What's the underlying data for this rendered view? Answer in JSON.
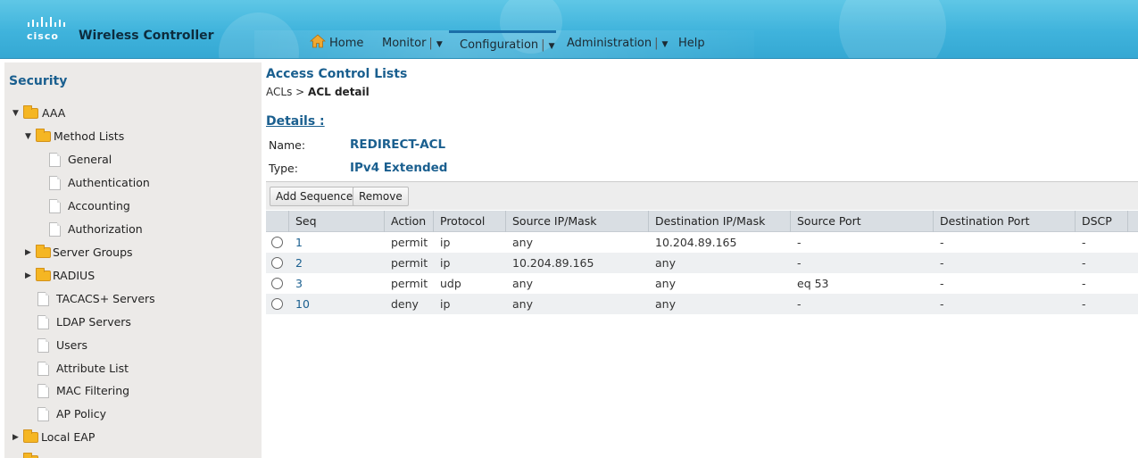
{
  "header": {
    "logo_text": "cisco",
    "brand": "Wireless Controller",
    "nav": [
      {
        "label": "Home",
        "icon": "home-icon",
        "dropdown": false,
        "active": false
      },
      {
        "label": "Monitor",
        "dropdown": true,
        "active": false
      },
      {
        "label": "Configuration",
        "dropdown": true,
        "active": true
      },
      {
        "label": "Administration",
        "dropdown": true,
        "active": false
      },
      {
        "label": "Help",
        "dropdown": false,
        "active": false
      }
    ],
    "dropdown_glyph": "▼",
    "separator": "|"
  },
  "sidebar": {
    "title": "Security",
    "items": [
      {
        "label": "AAA",
        "type": "folder",
        "expanded": true,
        "arrow": "▼"
      },
      {
        "label": "Method Lists",
        "type": "folder",
        "expanded": true,
        "arrow": "▼"
      },
      {
        "label": "General",
        "type": "doc"
      },
      {
        "label": "Authentication",
        "type": "doc"
      },
      {
        "label": "Accounting",
        "type": "doc"
      },
      {
        "label": "Authorization",
        "type": "doc"
      },
      {
        "label": "Server Groups",
        "type": "folder",
        "expanded": false,
        "arrow": "▶"
      },
      {
        "label": "RADIUS",
        "type": "folder",
        "expanded": false,
        "arrow": "▶"
      },
      {
        "label": "TACACS+ Servers",
        "type": "doc"
      },
      {
        "label": "LDAP Servers",
        "type": "doc"
      },
      {
        "label": "Users",
        "type": "doc"
      },
      {
        "label": "Attribute List",
        "type": "doc"
      },
      {
        "label": "MAC Filtering",
        "type": "doc"
      },
      {
        "label": "AP Policy",
        "type": "doc"
      },
      {
        "label": "Local EAP",
        "type": "folder",
        "expanded": false,
        "arrow": "▶"
      }
    ]
  },
  "main": {
    "title": "Access Control Lists",
    "breadcrumb": {
      "root": "ACLs",
      "sep": ">",
      "current": "ACL detail"
    },
    "details_heading": "Details :",
    "name_label": "Name:",
    "name_value": "REDIRECT-ACL",
    "type_label": "Type:",
    "type_value": "IPv4 Extended",
    "buttons": {
      "add": "Add Sequence",
      "remove": "Remove"
    },
    "columns": [
      "Seq",
      "Action",
      "Protocol",
      "Source IP/Mask",
      "Destination IP/Mask",
      "Source Port",
      "Destination Port",
      "DSCP"
    ],
    "rows": [
      {
        "seq": "1",
        "action": "permit",
        "protocol": "ip",
        "src": "any",
        "dst": "10.204.89.165",
        "sport": "-",
        "dport": "-",
        "dscp": "-"
      },
      {
        "seq": "2",
        "action": "permit",
        "protocol": "ip",
        "src": "10.204.89.165",
        "dst": "any",
        "sport": "-",
        "dport": "-",
        "dscp": "-"
      },
      {
        "seq": "3",
        "action": "permit",
        "protocol": "udp",
        "src": "any",
        "dst": "any",
        "sport": "eq 53",
        "dport": "-",
        "dscp": "-"
      },
      {
        "seq": "10",
        "action": "deny",
        "protocol": "ip",
        "src": "any",
        "dst": "any",
        "sport": "-",
        "dport": "-",
        "dscp": "-"
      }
    ]
  },
  "colors": {
    "accent": "#1a5f8f",
    "header": "#3fb3dc",
    "sidebar_bg": "#eceae8"
  }
}
